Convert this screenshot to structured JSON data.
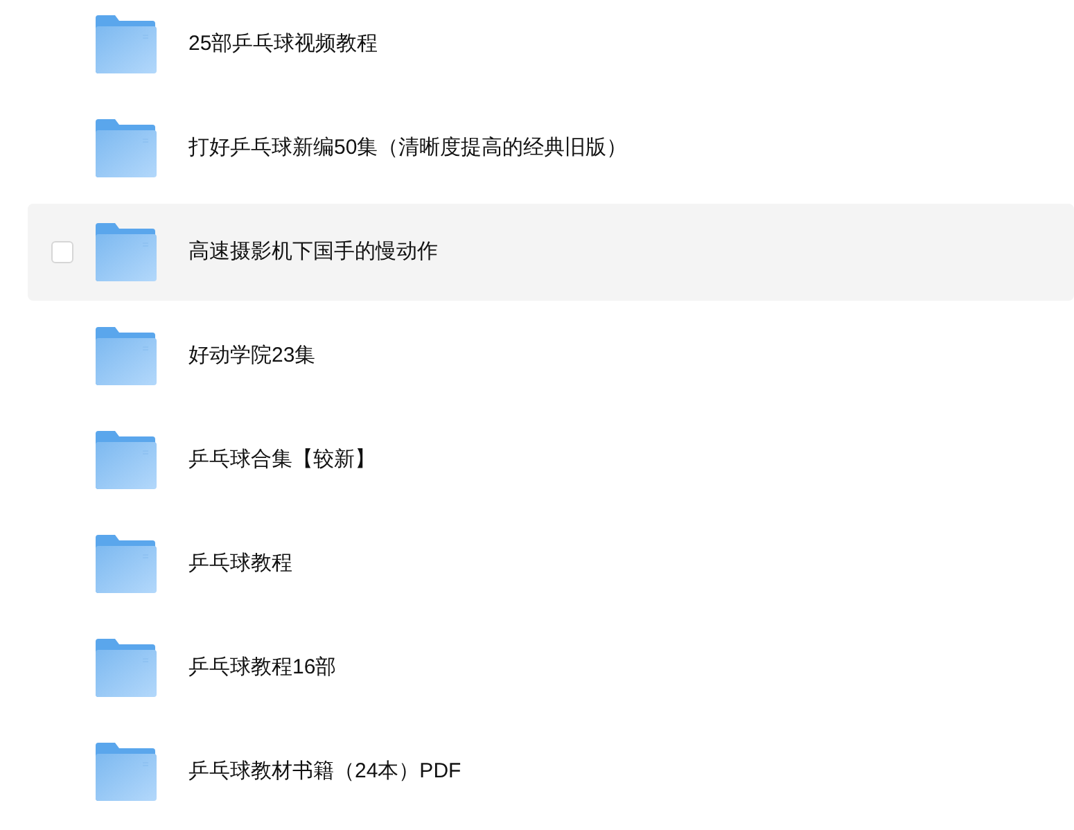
{
  "folders": [
    {
      "name": "25部乒乓球视频教程",
      "hovered": false
    },
    {
      "name": "打好乒乓球新编50集（清晰度提高的经典旧版）",
      "hovered": false
    },
    {
      "name": "高速摄影机下国手的慢动作",
      "hovered": true,
      "checked": false
    },
    {
      "name": "好动学院23集",
      "hovered": false
    },
    {
      "name": "乒乓球合集【较新】",
      "hovered": false
    },
    {
      "name": "乒乓球教程",
      "hovered": false
    },
    {
      "name": "乒乓球教程16部",
      "hovered": false
    },
    {
      "name": "乒乓球教材书籍（24本）PDF",
      "hovered": false
    }
  ]
}
